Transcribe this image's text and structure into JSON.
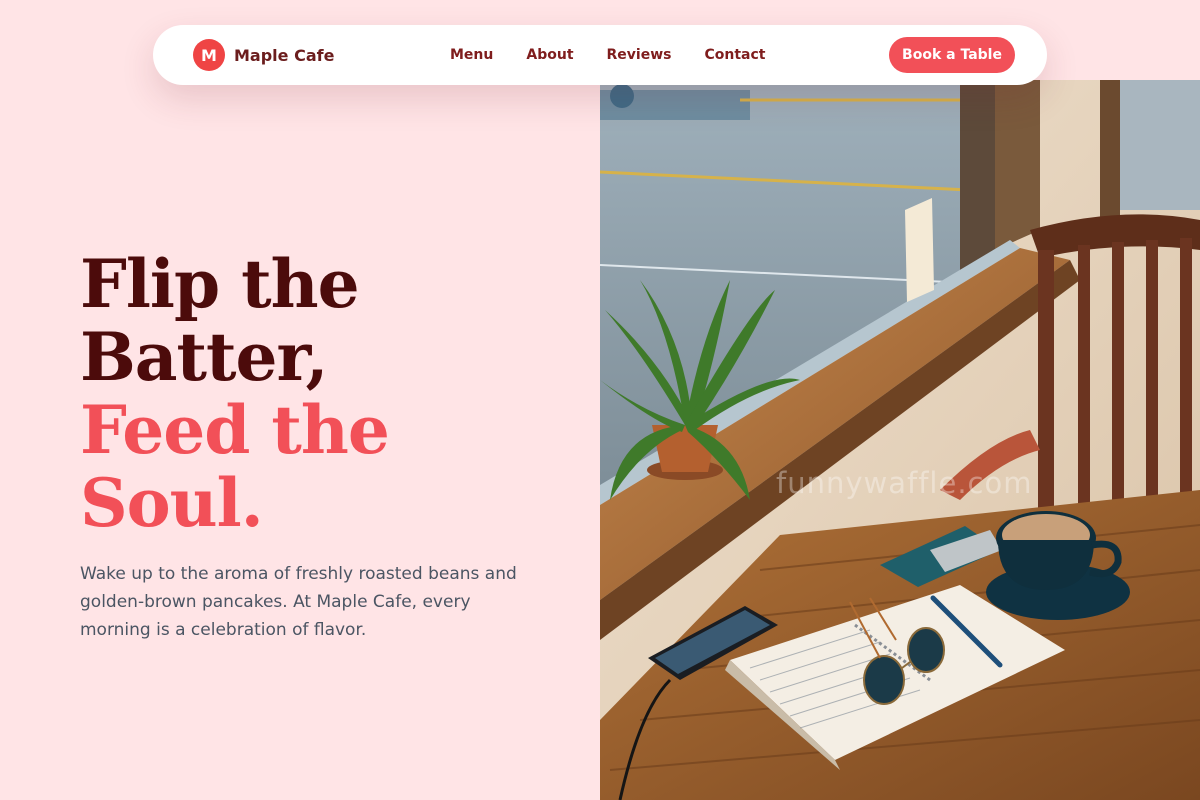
{
  "brand": {
    "logo_letter": "M",
    "name": "Maple Cafe"
  },
  "nav": {
    "links": [
      {
        "label": "Menu"
      },
      {
        "label": "About"
      },
      {
        "label": "Reviews"
      },
      {
        "label": "Contact"
      }
    ],
    "cta_label": "Book a Table"
  },
  "hero": {
    "title_lines": [
      "Flip the",
      "Batter,"
    ],
    "accent_lines": [
      "Feed the",
      "Soul."
    ],
    "description": "Wake up to the aroma of freshly roasted beans and golden-brown pancakes. At Maple Cafe, every morning is a celebration of flavor.",
    "image_watermark": "funnywaffle.com"
  },
  "colors": {
    "background": "#ffe4e6",
    "accent": "#f25058",
    "heading_dark": "#4c0b0b",
    "brand_text": "#6b1d1d",
    "body_text": "#4b5563"
  },
  "icons": {
    "logo": "letter-m-circle"
  }
}
